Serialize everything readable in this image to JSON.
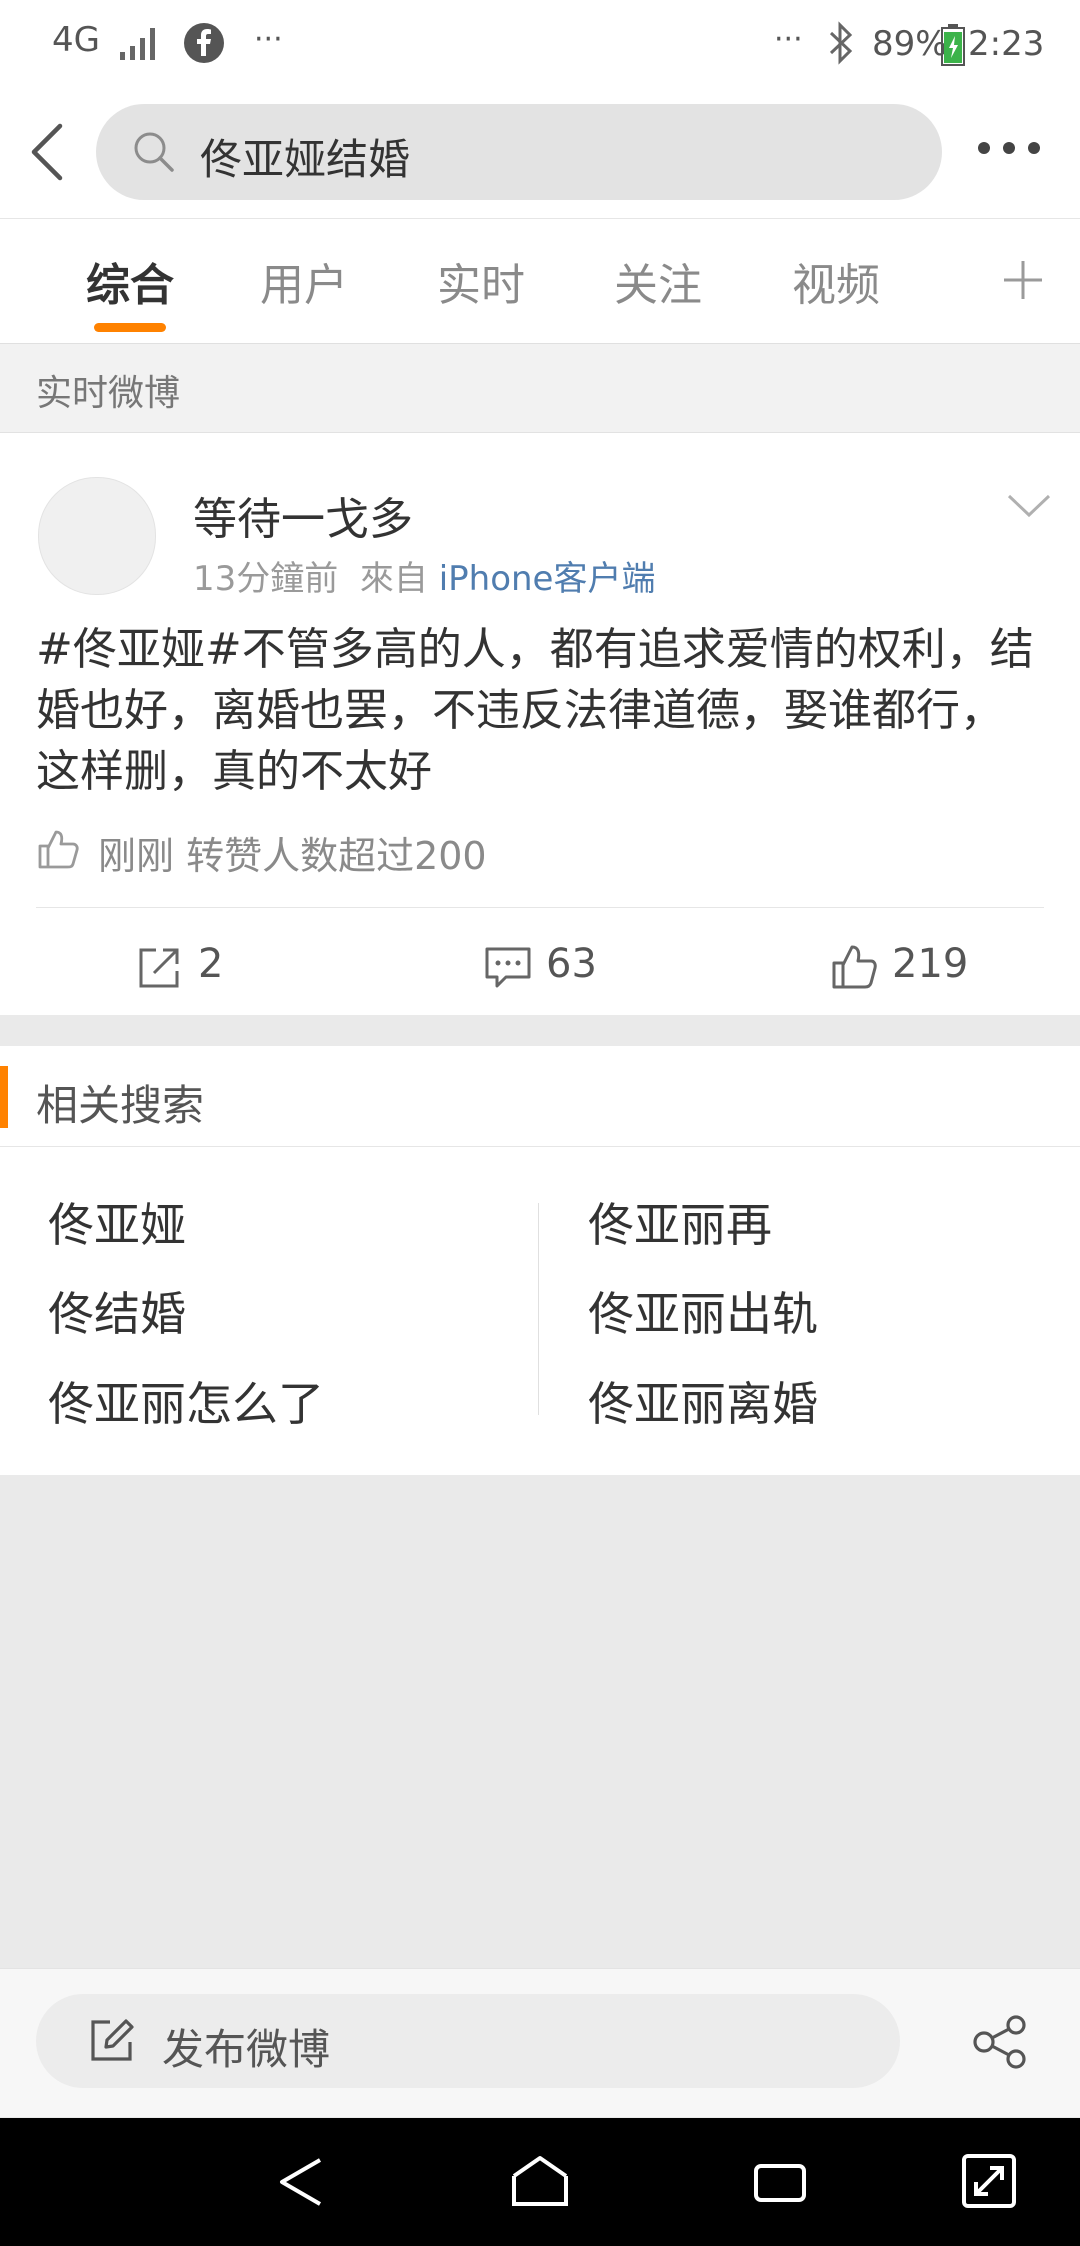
{
  "status_bar": {
    "network": "4G",
    "overflow_left": "···",
    "overflow_right": "···",
    "battery": "89%",
    "time": "2:23",
    "icons": [
      "signal-icon",
      "facebook-icon",
      "bluetooth-icon",
      "battery-icon"
    ]
  },
  "header": {
    "search_query": "佟亚娅结婚",
    "icons": [
      "back-arrow-icon",
      "search-icon",
      "more-dots-icon"
    ]
  },
  "tabs": [
    {
      "label": "综合",
      "active": true
    },
    {
      "label": "用户",
      "active": false
    },
    {
      "label": "实时",
      "active": false
    },
    {
      "label": "关注",
      "active": false
    },
    {
      "label": "视频",
      "active": false
    }
  ],
  "realtime_section": {
    "title": "实时微博"
  },
  "post": {
    "author": "等待一戈多",
    "time": "13分鐘前",
    "source_prefix": "來自",
    "source": "iPhone客户端",
    "text": "#佟亚娅#不管多高的人，都有追求爱情的权利，结婚也好，离婚也罢，不违反法律道德，娶谁都行，这样删，真的不太好",
    "like_notice": "刚刚 转赞人数超过200",
    "actions": {
      "repost": "2",
      "comment": "63",
      "like": "219"
    }
  },
  "related": {
    "title": "相关搜索",
    "left": [
      "佟亚娅",
      "佟结婚",
      "佟亚丽怎么了"
    ],
    "right": [
      "佟亚丽再",
      "佟亚丽出轨",
      "佟亚丽离婚"
    ]
  },
  "compose": {
    "label": "发布微博"
  },
  "accent_color": "#ff8200",
  "link_color": "#507daf"
}
